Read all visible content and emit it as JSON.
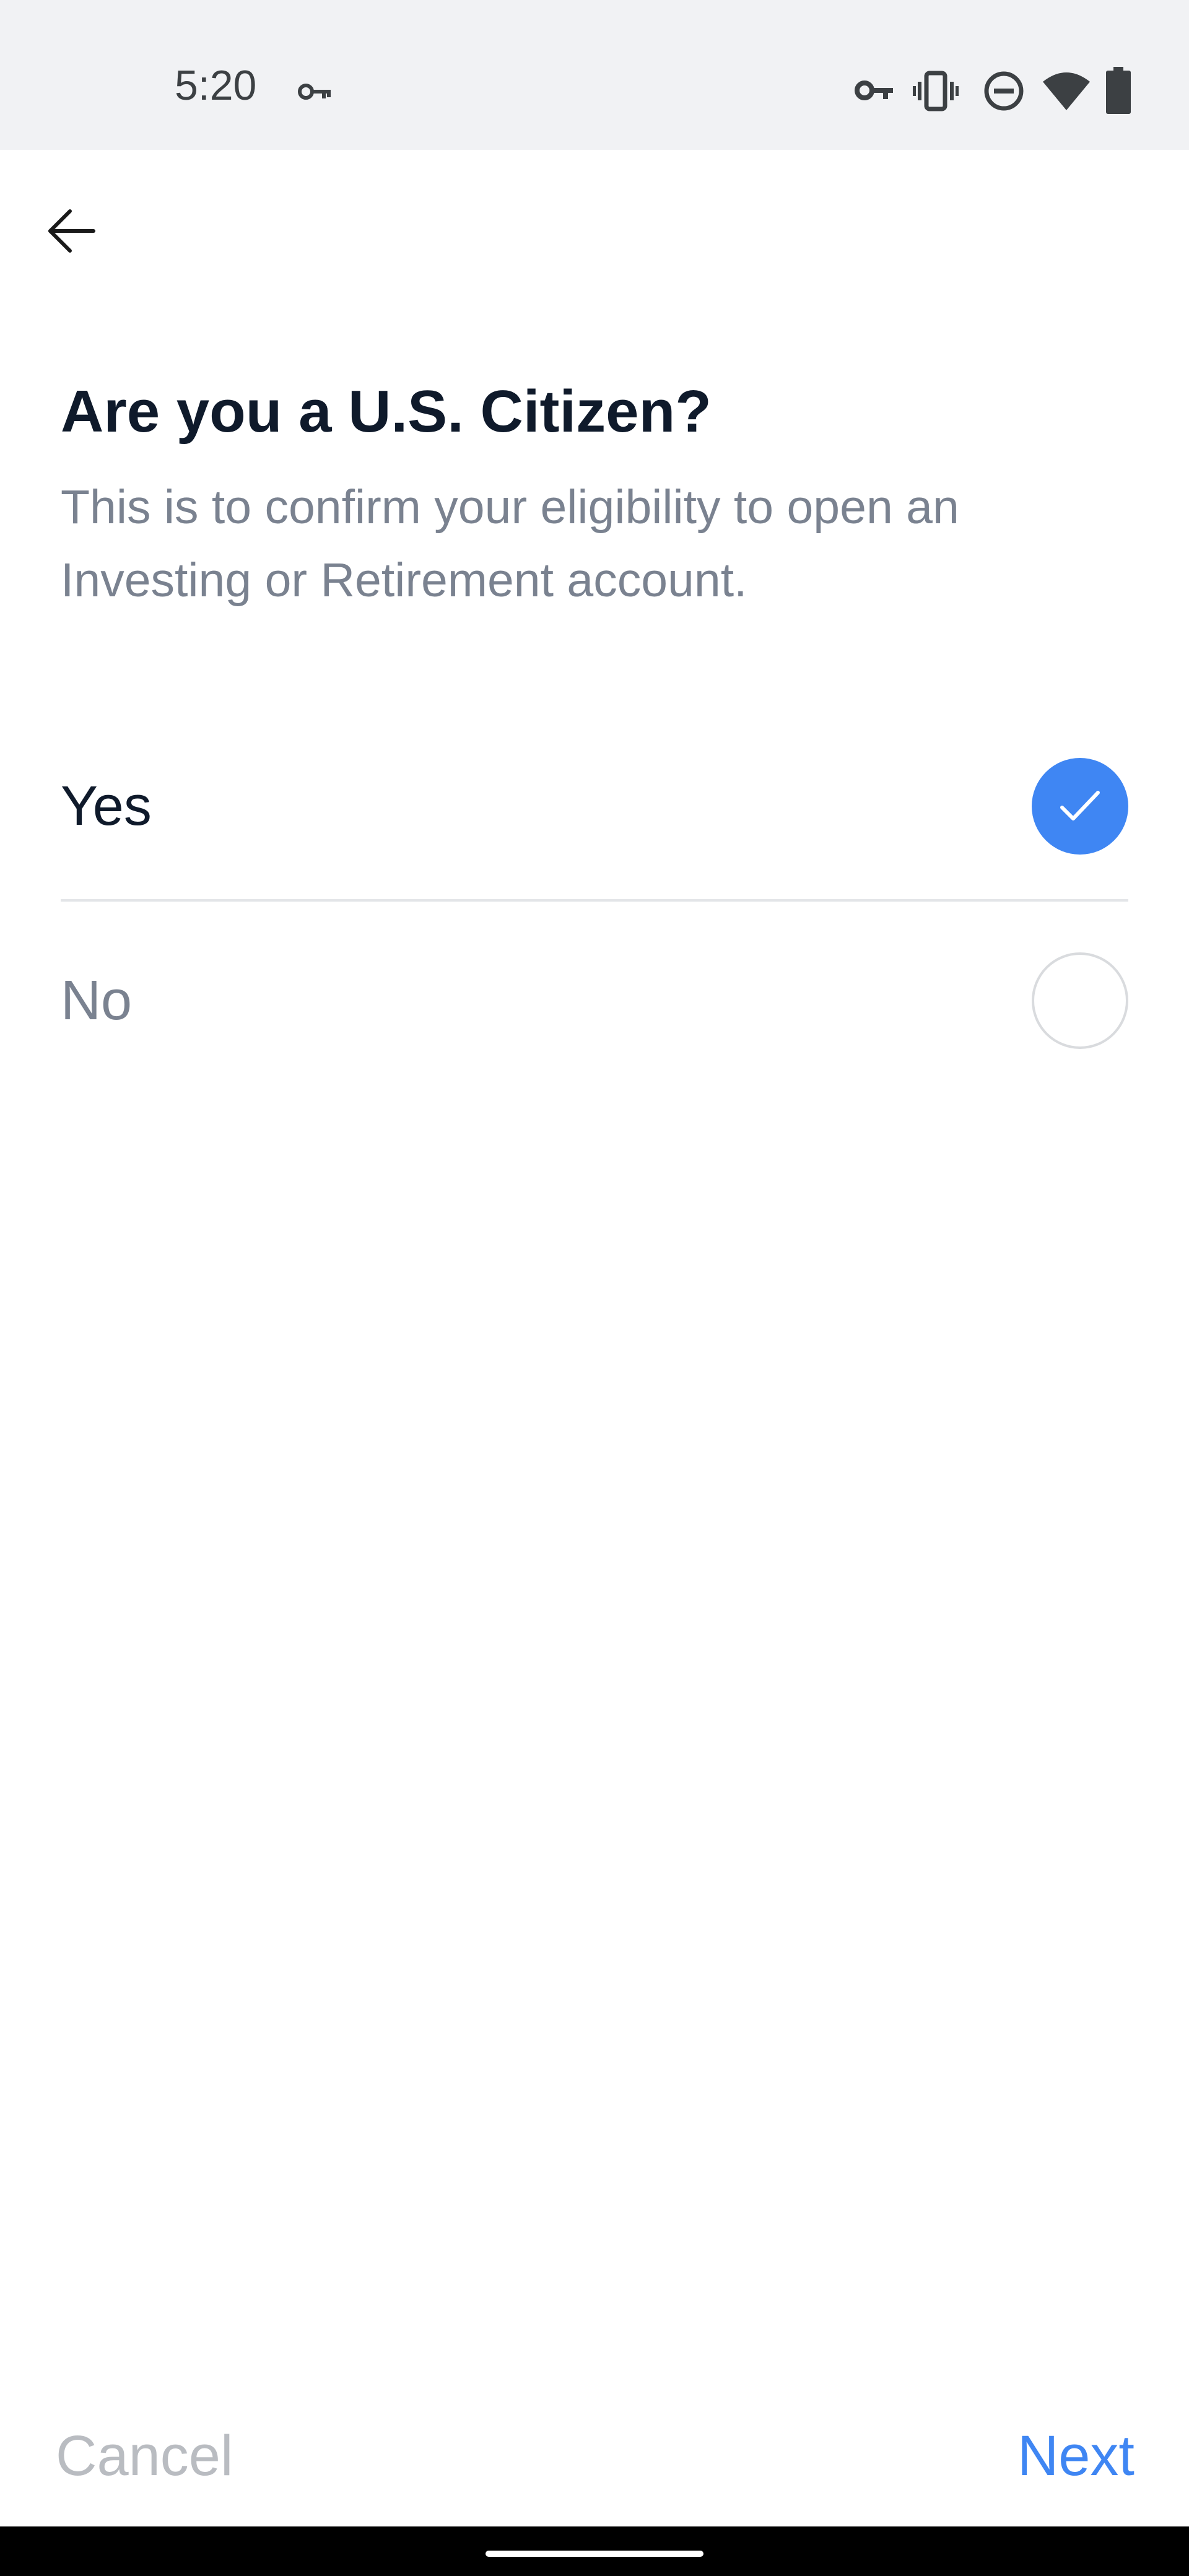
{
  "status_bar": {
    "time": "5:20",
    "icons": [
      "vpn-key-icon",
      "key-icon",
      "vibrate-icon",
      "do-not-disturb-icon",
      "wifi-icon",
      "battery-icon"
    ]
  },
  "header": {
    "back_icon": "arrow-back-icon"
  },
  "main": {
    "title": "Are you a U.S. Citizen?",
    "subtitle": "This is to confirm your eligibility to open an Investing or Retirement account.",
    "options": [
      {
        "label": "Yes",
        "selected": true
      },
      {
        "label": "No",
        "selected": false
      }
    ]
  },
  "footer": {
    "cancel_label": "Cancel",
    "next_label": "Next"
  },
  "colors": {
    "accent": "#3f86f3",
    "title": "#0f1a2b",
    "muted": "#7a8290",
    "cancel": "#b9bcc1",
    "status_bg": "#f1f2f4"
  }
}
